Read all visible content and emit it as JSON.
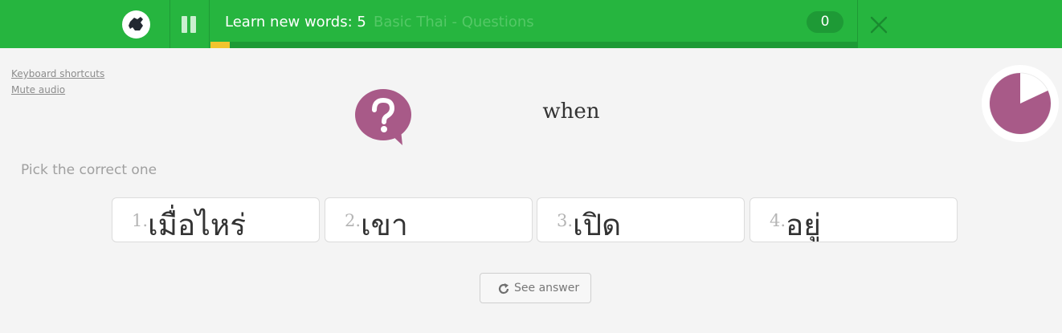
{
  "header": {
    "logo_icon": "memrise-hand-logo-icon",
    "pause_icon": "pause-icon",
    "title": "Learn new words: 5",
    "course": "Basic Thai - Questions",
    "score": "0",
    "close_icon": "close-icon",
    "progress_fraction": 0.03,
    "colors": {
      "bar": "#26b53f",
      "progress": "#f2c42e"
    }
  },
  "side_links": {
    "keyboard_shortcuts": "Keyboard shortcuts",
    "mute_audio": "Mute audio"
  },
  "prompt": {
    "icon": "question-bubble-icon",
    "word": "when",
    "timer_icon": "timer-pie-icon",
    "timer_remaining_fraction": 0.82
  },
  "instruction": "Pick the correct one",
  "choices": [
    {
      "num": "1.",
      "text": "เมื่อไหร่"
    },
    {
      "num": "2.",
      "text": "เขา"
    },
    {
      "num": "3.",
      "text": "เปิด"
    },
    {
      "num": "4.",
      "text": "อยู่"
    }
  ],
  "see_answer": {
    "label": "See answer",
    "icon": "refresh-icon"
  },
  "accent_color": "#a85a88"
}
